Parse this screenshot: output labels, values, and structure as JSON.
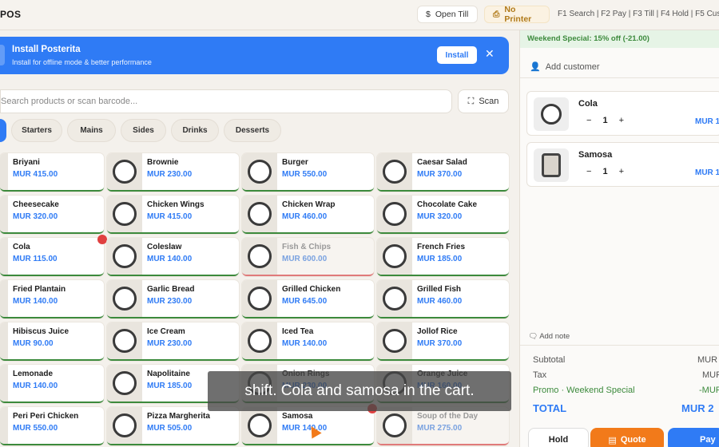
{
  "header": {
    "brand": "POS",
    "open_till": "Open Till",
    "no_printer": "No Printer",
    "shortcuts": "F1 Search | F2 Pay | F3 Till | F4 Hold | F5 Custo"
  },
  "install_banner": {
    "title": "Install Posterita",
    "subtitle": "Install for offline mode & better performance",
    "button": "Install",
    "close": "✕"
  },
  "search": {
    "placeholder": "Search products or scan barcode...",
    "scan_label": "Scan"
  },
  "categories": [
    "Starters",
    "Mains",
    "Sides",
    "Drinks",
    "Desserts"
  ],
  "products": [
    {
      "name": "Briyani",
      "price": "MUR 415.00"
    },
    {
      "name": "Brownie",
      "price": "MUR 230.00"
    },
    {
      "name": "Burger",
      "price": "MUR 550.00"
    },
    {
      "name": "Caesar Salad",
      "price": "MUR 370.00"
    },
    {
      "name": "Cheesecake",
      "price": "MUR 320.00"
    },
    {
      "name": "Chicken Wings",
      "price": "MUR 415.00"
    },
    {
      "name": "Chicken Wrap",
      "price": "MUR 460.00"
    },
    {
      "name": "Chocolate Cake",
      "price": "MUR 320.00"
    },
    {
      "name": "Cola",
      "price": "MUR 115.00"
    },
    {
      "name": "Coleslaw",
      "price": "MUR 140.00"
    },
    {
      "name": "Fish & Chips",
      "price": "MUR 600.00"
    },
    {
      "name": "French Fries",
      "price": "MUR 185.00"
    },
    {
      "name": "Fried Plantain",
      "price": "MUR 140.00"
    },
    {
      "name": "Garlic Bread",
      "price": "MUR 230.00"
    },
    {
      "name": "Grilled Chicken",
      "price": "MUR 645.00"
    },
    {
      "name": "Grilled Fish",
      "price": "MUR 460.00"
    },
    {
      "name": "Hibiscus Juice",
      "price": "MUR 90.00"
    },
    {
      "name": "Ice Cream",
      "price": "MUR 230.00"
    },
    {
      "name": "Iced Tea",
      "price": "MUR 140.00"
    },
    {
      "name": "Jollof Rice",
      "price": "MUR 370.00"
    },
    {
      "name": "Lemonade",
      "price": "MUR 140.00"
    },
    {
      "name": "Napolitaine",
      "price": "MUR 185.00"
    },
    {
      "name": "Onion Rings",
      "price": "MUR 230.00"
    },
    {
      "name": "Orange Juice",
      "price": "MUR 160.00"
    },
    {
      "name": "Peri Peri Chicken",
      "price": "MUR 550.00"
    },
    {
      "name": "Pizza Margherita",
      "price": "MUR 505.00"
    },
    {
      "name": "Samosa",
      "price": "MUR 140.00"
    },
    {
      "name": "Soup of the Day",
      "price": "MUR 275.00"
    }
  ],
  "cart": {
    "promo": "Weekend Special: 15% off (-21.00)",
    "add_customer": "Add customer",
    "items": [
      {
        "name": "Cola",
        "qty": "1",
        "price": "MUR 1"
      },
      {
        "name": "Samosa",
        "qty": "1",
        "price": "MUR 1"
      }
    ],
    "add_note": "Add note",
    "subtotal_label": "Subtotal",
    "subtotal_value": "MUR 1",
    "tax_label": "Tax",
    "tax_value": "MUR",
    "promo_label": "Promo · Weekend Special",
    "promo_value": "-MUR",
    "total_label": "TOTAL",
    "total_value": "MUR 2",
    "hold": "Hold",
    "quote": "Quote",
    "pay": "Pay"
  },
  "caption": "shift. Cola and samosa in the cart."
}
